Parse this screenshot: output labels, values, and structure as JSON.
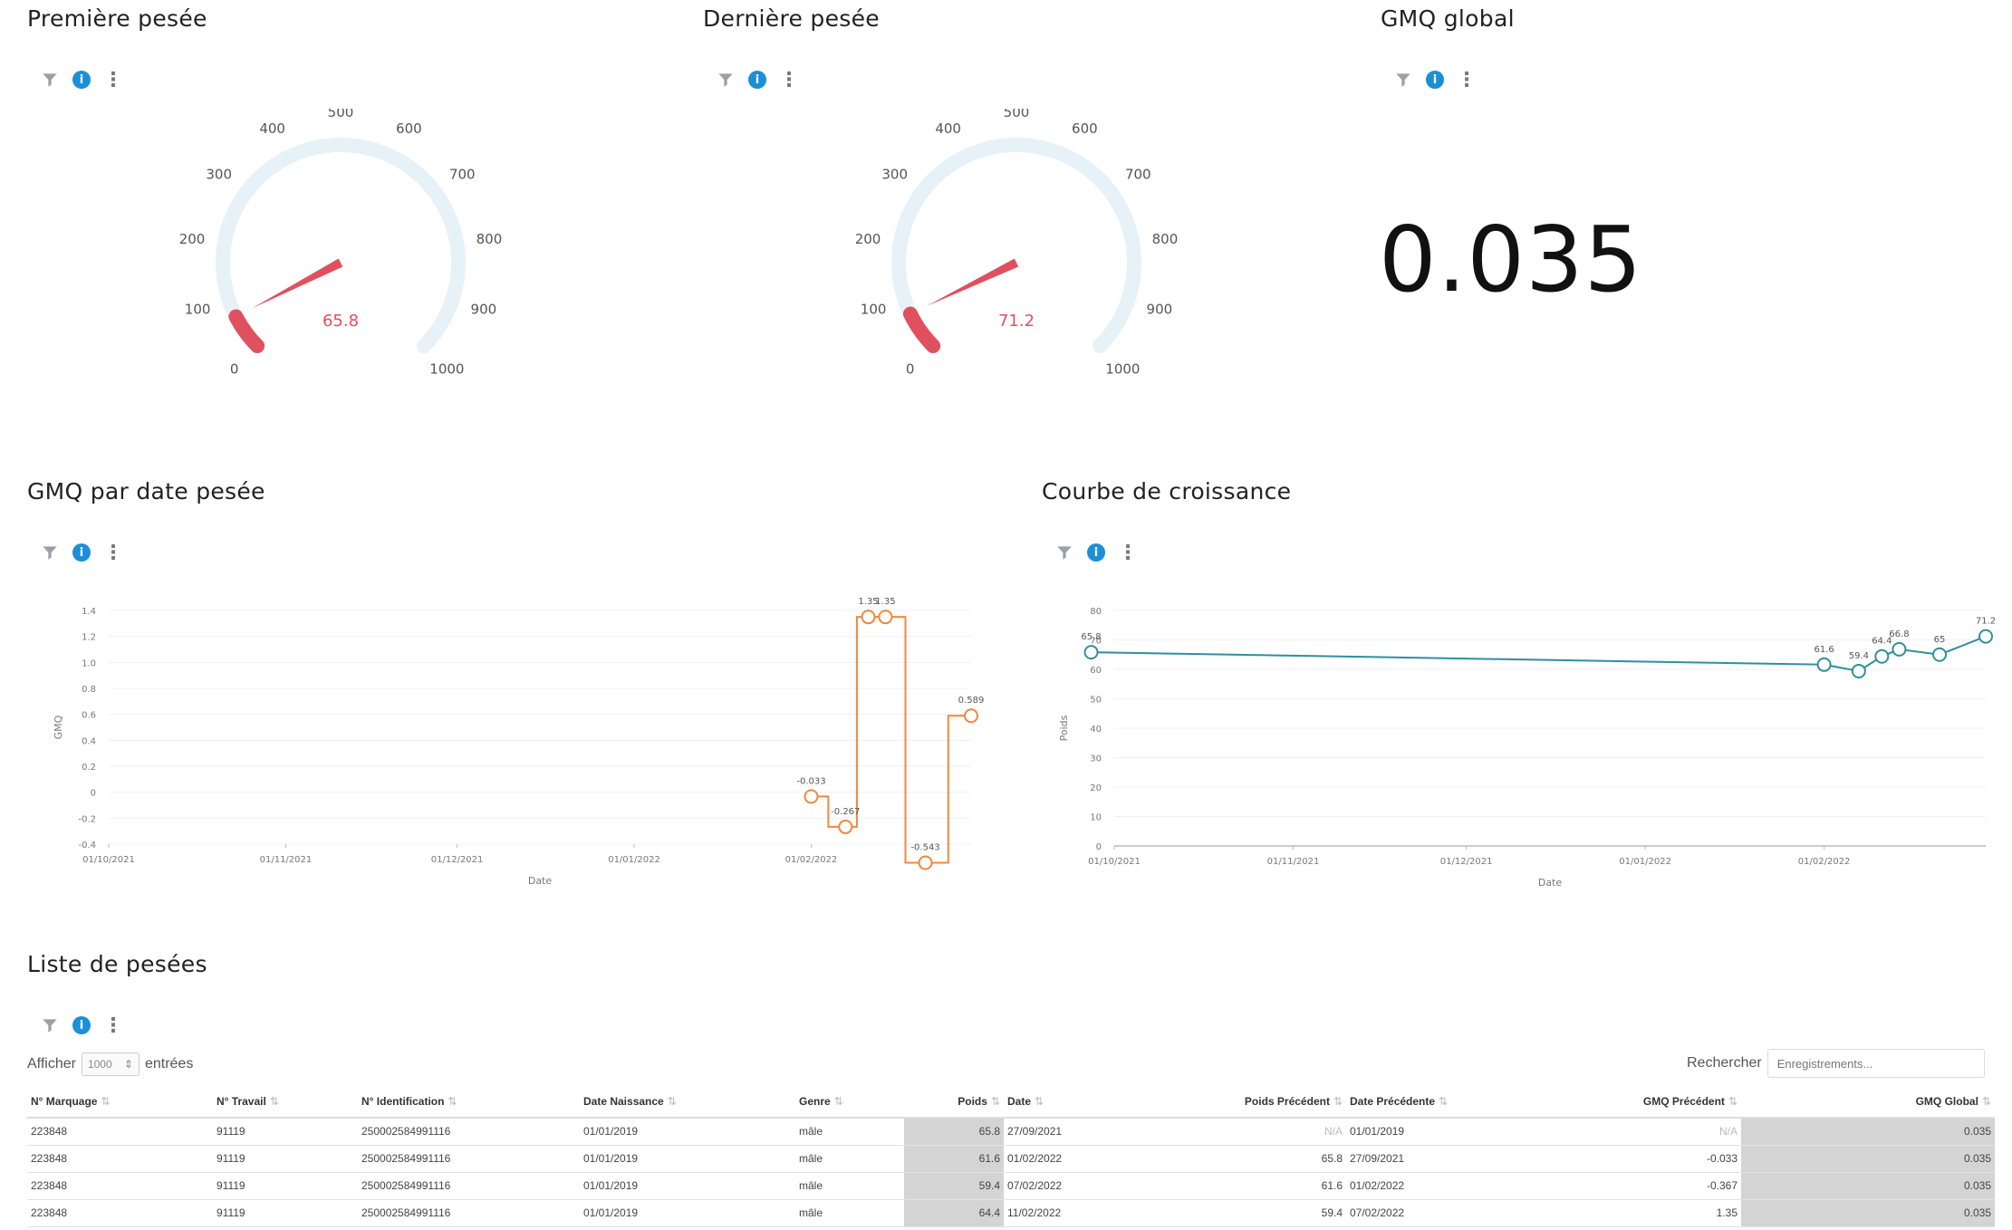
{
  "panels": {
    "first_weighing": {
      "title": "Première pesée",
      "value": 65.8,
      "value_label": "65.8"
    },
    "last_weighing": {
      "title": "Dernière pesée",
      "value": 71.2,
      "value_label": "71.2"
    },
    "gmq_global": {
      "title": "GMQ global",
      "value": "0.035"
    },
    "gmq_by_date": {
      "title": "GMQ par date pesée"
    },
    "growth_curve": {
      "title": "Courbe de croissance"
    },
    "weighing_list": {
      "title": "Liste de pesées"
    }
  },
  "gauge": {
    "min": 0,
    "max": 1000,
    "tick_labels": [
      "0",
      "100",
      "200",
      "300",
      "400",
      "500",
      "600",
      "700",
      "800",
      "900",
      "1000"
    ],
    "track_color": "#e6f2f7",
    "value_color": "#e0505e"
  },
  "toolbar": {
    "filter_icon": "filter-icon",
    "info_icon": "info-icon",
    "info_label": "i",
    "more_icon": "⋮"
  },
  "chart_data": [
    {
      "type": "line",
      "step": true,
      "xlabel": "Date",
      "ylabel": "GMQ",
      "x_ticks": [
        "01/10/2021",
        "01/11/2021",
        "01/12/2021",
        "01/01/2022",
        "01/02/2022"
      ],
      "y_ticks": [
        "1.4",
        "1.2",
        "1.0",
        "0.8",
        "0.6",
        "0.4",
        "0.2",
        "0",
        "-0.2",
        "-0.4"
      ],
      "ylim": [
        -0.4,
        1.4
      ],
      "color": "#f0883e",
      "series": [
        {
          "x": [
            "2022-02-01",
            "2022-02-07",
            "2022-02-11",
            "2022-02-14",
            "2022-02-21",
            "2022-03-01"
          ],
          "values": [
            -0.033,
            -0.267,
            1.35,
            1.35,
            -0.543,
            0.589
          ],
          "labels": [
            "-0.033",
            "-0.267",
            "1.35",
            "1.35",
            "-0.543",
            "0.589"
          ]
        }
      ]
    },
    {
      "type": "line",
      "xlabel": "Date",
      "ylabel": "Poids",
      "x_ticks": [
        "01/10/2021",
        "01/11/2021",
        "01/12/2021",
        "01/01/2022",
        "01/02/2022"
      ],
      "y_ticks": [
        "80",
        "70",
        "60",
        "50",
        "40",
        "30",
        "20",
        "10",
        "0"
      ],
      "ylim": [
        0,
        80
      ],
      "color": "#2f8f9d",
      "series": [
        {
          "x": [
            "2021-09-27",
            "2022-02-01",
            "2022-02-07",
            "2022-02-11",
            "2022-02-14",
            "2022-02-21",
            "2022-03-01"
          ],
          "values": [
            65.8,
            61.6,
            59.4,
            64.4,
            66.8,
            65,
            71.2
          ],
          "labels": [
            "65.8",
            "61.6",
            "59.4",
            "64.4",
            "66.8",
            "65",
            "71.2"
          ]
        }
      ]
    }
  ],
  "table": {
    "show_label": "Afficher",
    "page_size": "1000",
    "entries_label": "entrées",
    "search_label": "Rechercher",
    "search_placeholder": "Enregistrements...",
    "columns": [
      "N° Marquage",
      "N° Travail",
      "N° Identification",
      "Date Naissance",
      "Genre",
      "Poids",
      "Date",
      "Poids Précédent",
      "Date Précédente",
      "GMQ Précédent",
      "GMQ Global"
    ],
    "rows": [
      [
        "223848",
        "91119",
        "250002584991116",
        "01/01/2019",
        "mâle",
        "65.8",
        "27/09/2021",
        "N/A",
        "01/01/2019",
        "N/A",
        "0.035"
      ],
      [
        "223848",
        "91119",
        "250002584991116",
        "01/01/2019",
        "mâle",
        "61.6",
        "01/02/2022",
        "65.8",
        "27/09/2021",
        "-0.033",
        "0.035"
      ],
      [
        "223848",
        "91119",
        "250002584991116",
        "01/01/2019",
        "mâle",
        "59.4",
        "07/02/2022",
        "61.6",
        "01/02/2022",
        "-0.367",
        "0.035"
      ],
      [
        "223848",
        "91119",
        "250002584991116",
        "01/01/2019",
        "mâle",
        "64.4",
        "11/02/2022",
        "59.4",
        "07/02/2022",
        "1.35",
        "0.035"
      ]
    ]
  }
}
